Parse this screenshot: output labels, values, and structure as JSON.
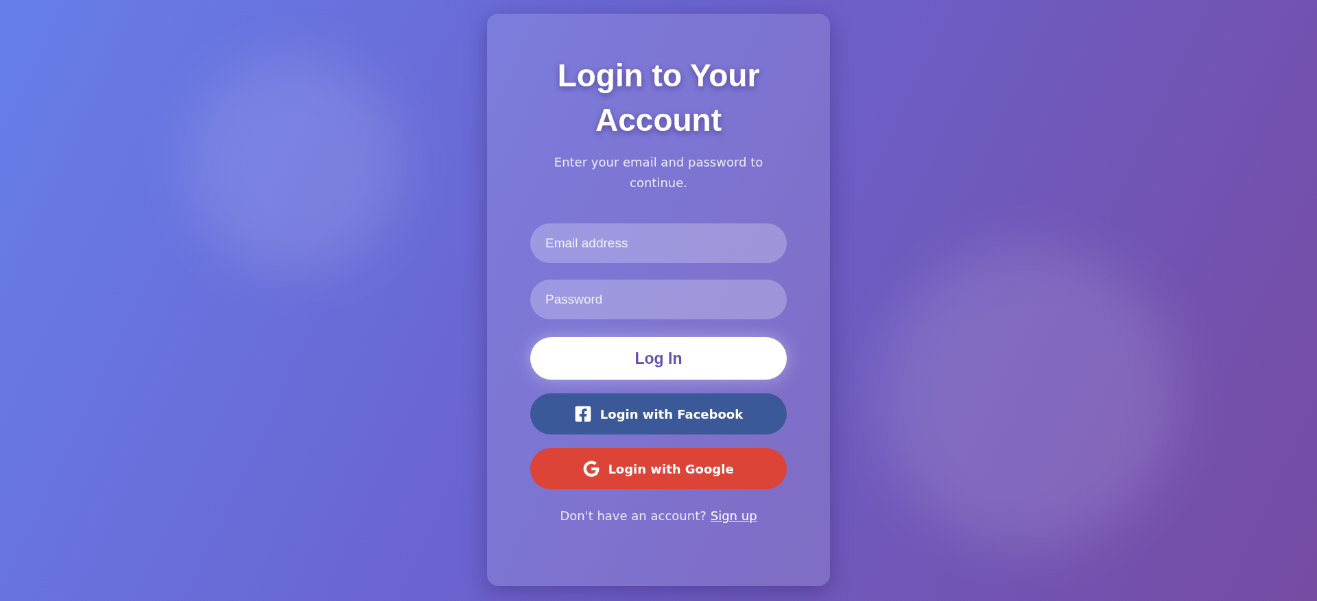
{
  "card": {
    "title": "Login to Your Account",
    "subtitle": "Enter your email and password to continue.",
    "fields": [
      {
        "placeholder": "Email address"
      },
      {
        "placeholder": "Password"
      }
    ],
    "buttons": [
      {
        "kind": "primary",
        "label": "Log In"
      },
      {
        "kind": "facebook",
        "label": "Login with Facebook"
      },
      {
        "kind": "google",
        "label": "Login with Google"
      }
    ],
    "footer": {
      "text": "Don't have an account?",
      "link": "Sign up"
    }
  }
}
